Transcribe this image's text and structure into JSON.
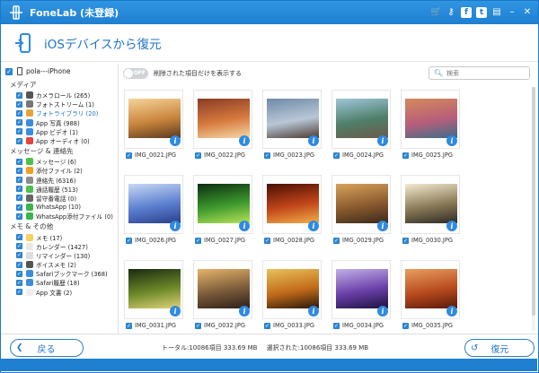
{
  "app": {
    "title": "FoneLab (未登録)"
  },
  "titlebar_icons": [
    "cart-icon",
    "key-icon",
    "facebook-icon",
    "twitter-icon",
    "feedback-icon",
    "minimize-icon",
    "close-icon"
  ],
  "header": {
    "title": "iOSデバイスから復元"
  },
  "device": {
    "name": "pola---iPhone"
  },
  "sidebar": {
    "categories": [
      {
        "name": "メディア",
        "items": [
          {
            "label": "カメラロール (265)",
            "icon_color": "#555555"
          },
          {
            "label": "フォトストリーム (1)",
            "icon_color": "#777777"
          },
          {
            "label": "フォトライブラリ (20)",
            "icon_color": "#e9a23b",
            "selected": true
          },
          {
            "label": "App 写真 (988)",
            "icon_color": "#3a8de0"
          },
          {
            "label": "App ビデオ (1)",
            "icon_color": "#3a8de0"
          },
          {
            "label": "App オーディオ (0)",
            "icon_color": "#e2453c"
          }
        ]
      },
      {
        "name": "メッセージ & 連絡先",
        "items": [
          {
            "label": "メッセージ (6)",
            "icon_color": "#4cc24a"
          },
          {
            "label": "添付ファイル (2)",
            "icon_color": "#f0a020"
          },
          {
            "label": "連絡先 (6316)",
            "icon_color": "#8d8d8d"
          },
          {
            "label": "通話履歴 (513)",
            "icon_color": "#4cc24a"
          },
          {
            "label": "留守番電話 (0)",
            "icon_color": "#666666"
          },
          {
            "label": "WhatsApp (10)",
            "icon_color": "#3bb54a"
          },
          {
            "label": "WhatsApp添付ファイル (0)",
            "icon_color": "#3bb54a"
          }
        ]
      },
      {
        "name": "メモ & その他",
        "items": [
          {
            "label": "メモ (17)",
            "icon_color": "#f4d35e"
          },
          {
            "label": "カレンダー (1427)",
            "icon_color": "#e9e9e9"
          },
          {
            "label": "リマインダー (130)",
            "icon_color": "#dddddd"
          },
          {
            "label": "ボイスメモ (2)",
            "icon_color": "#555555"
          },
          {
            "label": "Safariブックマーク (368)",
            "icon_color": "#3a8de0"
          },
          {
            "label": "Safari履歴 (18)",
            "icon_color": "#3a8de0"
          },
          {
            "label": "App 文書 (2)",
            "icon_color": "#eeeeee"
          }
        ]
      }
    ]
  },
  "toolbar": {
    "toggle_label": "OFF",
    "filter_label": "削除された項目だけを表示する",
    "search_placeholder": "検索"
  },
  "photos": [
    {
      "name": "IMG_0021.JPG",
      "colors": [
        "#f6d49a",
        "#c9853d",
        "#5a3a1f"
      ]
    },
    {
      "name": "IMG_0022.JPG",
      "colors": [
        "#8a3b25",
        "#d77a3e",
        "#f4d8a8"
      ]
    },
    {
      "name": "IMG_0023.JPG",
      "colors": [
        "#6f8aa8",
        "#b9c7d6",
        "#4a3b32"
      ]
    },
    {
      "name": "IMG_0024.JPG",
      "colors": [
        "#9fc6d9",
        "#4f7f6a",
        "#6b5a4a"
      ]
    },
    {
      "name": "IMG_0025.JPG",
      "colors": [
        "#d48a5a",
        "#b85e7a",
        "#3d6e8a"
      ]
    },
    {
      "name": "IMG_0026.JPG",
      "colors": [
        "#c8d8f2",
        "#5b7fd0",
        "#2b3f8a"
      ]
    },
    {
      "name": "IMG_0027.JPG",
      "colors": [
        "#0b2e12",
        "#3f9a2e",
        "#b7e35a"
      ]
    },
    {
      "name": "IMG_0028.JPG",
      "colors": [
        "#4a0f05",
        "#c3461a",
        "#f0b04a"
      ]
    },
    {
      "name": "IMG_0029.JPG",
      "colors": [
        "#d7a25a",
        "#8a5a2e",
        "#3b2a1a"
      ]
    },
    {
      "name": "IMG_0030.JPG",
      "colors": [
        "#f4ead0",
        "#8a7a58",
        "#2d2a24"
      ]
    },
    {
      "name": "IMG_0031.JPG",
      "colors": [
        "#1a2a10",
        "#6e8a2a",
        "#e0d27a"
      ]
    },
    {
      "name": "IMG_0032.JPG",
      "colors": [
        "#e6b46a",
        "#7a5a3a",
        "#2d2018"
      ]
    },
    {
      "name": "IMG_0033.JPG",
      "colors": [
        "#e8c25a",
        "#c26a1a",
        "#2a1a0a"
      ]
    },
    {
      "name": "IMG_0034.JPG",
      "colors": [
        "#c2b0e8",
        "#6a3fa8",
        "#1e1240"
      ]
    },
    {
      "name": "IMG_0035.JPG",
      "colors": [
        "#e8a060",
        "#b84a1e",
        "#5a1a0a"
      ]
    }
  ],
  "footer": {
    "back_label": "戻る",
    "restore_label": "復元",
    "total": "トータル:10086項目 333.69 MB",
    "selected": "選択された:10086項目 333.69 MB"
  }
}
